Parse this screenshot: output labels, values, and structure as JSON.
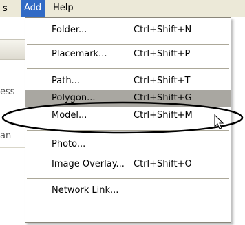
{
  "menubar": {
    "prev_fragment": "s",
    "add_label": "Add",
    "help_label": "Help"
  },
  "app_fragments": {
    "line1": "ess",
    "line2": "an"
  },
  "menu": {
    "items": [
      {
        "label": "Folder...",
        "shortcut": "Ctrl+Shift+N"
      },
      {
        "label": "Placemark...",
        "shortcut": "Ctrl+Shift+P"
      },
      {
        "label": "Path...",
        "shortcut": "Ctrl+Shift+T"
      },
      {
        "label": "Polygon...",
        "shortcut": "Ctrl+Shift+G"
      },
      {
        "label": "Model...",
        "shortcut": "Ctrl+Shift+M"
      },
      {
        "label": "Photo...",
        "shortcut": ""
      },
      {
        "label": "Image Overlay...",
        "shortcut": "Ctrl+Shift+O"
      },
      {
        "label": "Network Link...",
        "shortcut": ""
      }
    ],
    "highlighted_item": "Polygon..."
  },
  "colors": {
    "menu_selection": "#316ac5",
    "item_highlight": "#a9a7a1",
    "annotation": "#000000"
  }
}
